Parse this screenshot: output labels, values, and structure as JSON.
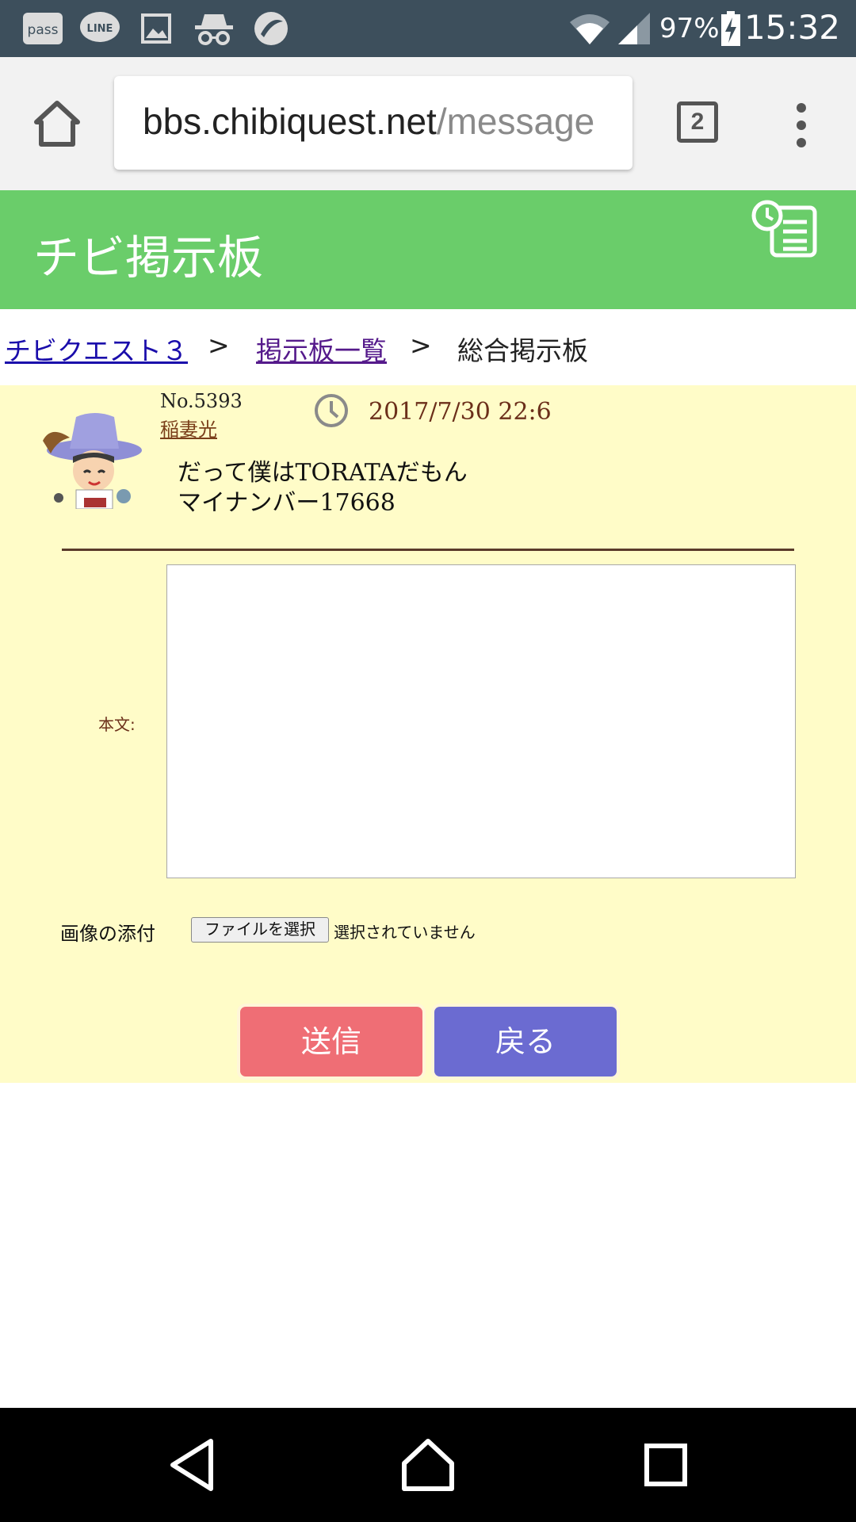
{
  "status_bar": {
    "time": "15:32",
    "battery_percent": "97%",
    "left_icons": [
      "pass-icon",
      "line-icon",
      "gallery-icon",
      "incognito-icon",
      "app-icon"
    ],
    "left_icon_texts": [
      "pass",
      "LINE"
    ],
    "icon_color": "#ffffff"
  },
  "browser": {
    "url_host": "bbs.chibiquest.net",
    "url_path": "/message",
    "tab_count": "2"
  },
  "site": {
    "title": "チビ掲示板",
    "header_color": "#6acd6a"
  },
  "breadcrumb": {
    "items": [
      "チビクエスト３",
      "掲示板一覧",
      "総合掲示板"
    ],
    "separator": ">"
  },
  "post": {
    "number": "No.5393",
    "user": "稲妻光",
    "date": "2017/7/30 22:6",
    "body_line1": "だって僕はTORATAだもん",
    "body_line2": "マイナンバー17668"
  },
  "form": {
    "body_label": "本文:",
    "body_value": "",
    "attach_label": "画像の添付",
    "file_button": "ファイルを選択",
    "file_status": "選択されていません",
    "send_label": "送信",
    "back_label": "戻る",
    "send_color": "#ef6e75",
    "back_color": "#6b6bd1"
  },
  "nav_bar": {
    "buttons": [
      "back-icon",
      "home-icon",
      "recents-icon"
    ]
  }
}
